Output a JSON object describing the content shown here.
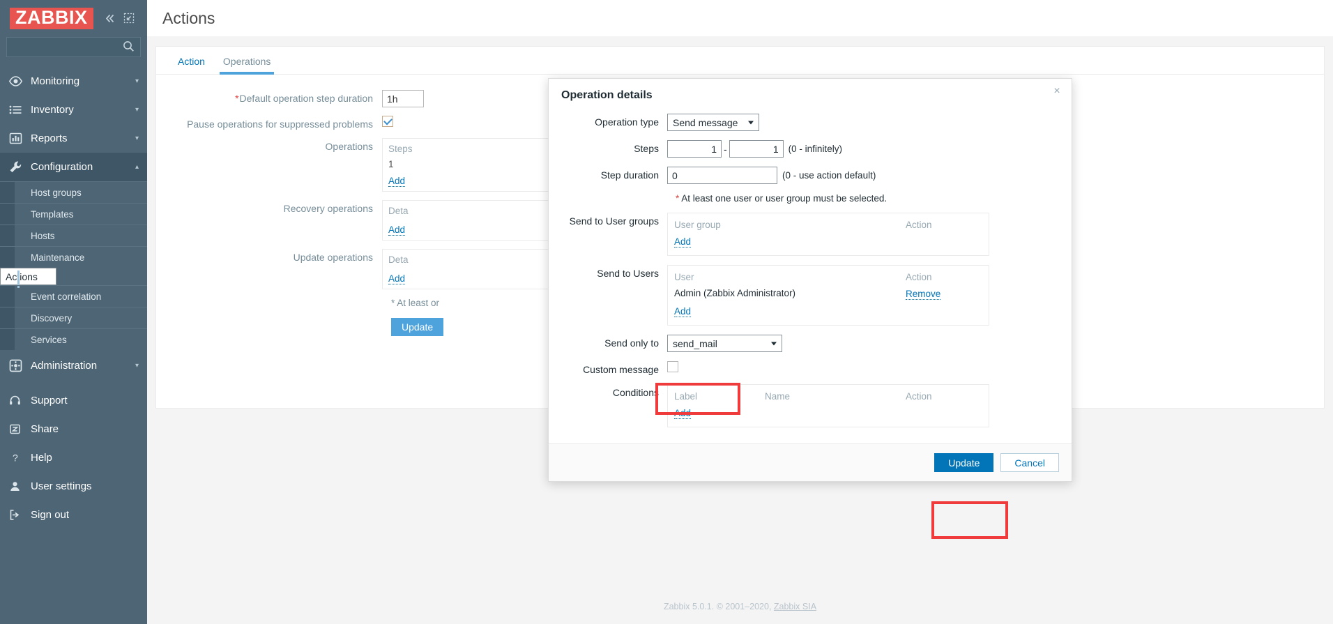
{
  "brand": {
    "name": "ZABBIX"
  },
  "sidebar": {
    "collapse_icon": "chevrons-left-icon",
    "expand_icon": "expand-icon",
    "search": {
      "placeholder": "",
      "value": "",
      "icon": "search-icon"
    },
    "groups": [
      {
        "label": "Monitoring",
        "icon": "eye-icon",
        "expanded": false
      },
      {
        "label": "Inventory",
        "icon": "list-icon",
        "expanded": false
      },
      {
        "label": "Reports",
        "icon": "bar-chart-icon",
        "expanded": false
      },
      {
        "label": "Configuration",
        "icon": "wrench-icon",
        "expanded": true
      }
    ],
    "configuration_items": [
      {
        "label": "Host groups",
        "selected": false
      },
      {
        "label": "Templates",
        "selected": false
      },
      {
        "label": "Hosts",
        "selected": false
      },
      {
        "label": "Maintenance",
        "selected": false
      },
      {
        "label": "Actions",
        "selected": true
      },
      {
        "label": "Event correlation",
        "selected": false
      },
      {
        "label": "Discovery",
        "selected": false
      },
      {
        "label": "Services",
        "selected": false
      }
    ],
    "administration": {
      "label": "Administration",
      "icon": "cog-square-icon"
    },
    "links": [
      {
        "label": "Support",
        "icon": "headset-icon"
      },
      {
        "label": "Share",
        "icon": "zabbix-z-icon"
      },
      {
        "label": "Help",
        "icon": "question-icon"
      },
      {
        "label": "User settings",
        "icon": "user-icon"
      },
      {
        "label": "Sign out",
        "icon": "sign-out-icon"
      }
    ]
  },
  "page": {
    "title": "Actions",
    "footer_text": "Zabbix 5.0.1. © 2001–2020, ",
    "footer_link": "Zabbix SIA"
  },
  "tabs": [
    {
      "label": "Action",
      "active": false
    },
    {
      "label": "Operations",
      "active": true
    }
  ],
  "background_form": {
    "default_step_duration": {
      "label": "Default operation step duration",
      "required": true,
      "value": "1h"
    },
    "pause_suppressed": {
      "label": "Pause operations for suppressed problems",
      "checked": true
    },
    "operations": {
      "label": "Operations",
      "header": "Steps",
      "row_value": "1",
      "add_label": "Add"
    },
    "recovery_operations": {
      "label": "Recovery operations",
      "header": "Deta",
      "add_label": "Add"
    },
    "update_operations": {
      "label": "Update operations",
      "header": "Deta",
      "add_label": "Add"
    },
    "note": "* At least or",
    "update_button": "Update"
  },
  "modal": {
    "title": "Operation details",
    "close_icon": "close-icon",
    "operation_type": {
      "label": "Operation type",
      "value": "Send message"
    },
    "steps": {
      "label": "Steps",
      "from": "1",
      "to": "1",
      "separator": "-",
      "hint": "(0 - infinitely)"
    },
    "step_duration": {
      "label": "Step duration",
      "value": "0",
      "hint": "(0 - use action default)"
    },
    "required_note": "At least one user or user group must be selected.",
    "send_to_user_groups": {
      "label": "Send to User groups",
      "columns": [
        "User group",
        "Action"
      ],
      "rows": [],
      "add_label": "Add"
    },
    "send_to_users": {
      "label": "Send to Users",
      "columns": [
        "User",
        "Action"
      ],
      "rows": [
        {
          "user": "Admin (Zabbix Administrator)",
          "action": "Remove"
        }
      ],
      "add_label": "Add"
    },
    "send_only_to": {
      "label": "Send only to",
      "value": "send_mail"
    },
    "custom_message": {
      "label": "Custom message",
      "checked": false
    },
    "conditions": {
      "label": "Conditions",
      "columns": [
        "Label",
        "Name",
        "Action"
      ],
      "rows": [],
      "add_label": "Add"
    },
    "footer": {
      "update_label": "Update",
      "cancel_label": "Cancel"
    }
  },
  "highlights": {
    "accent_red": "#ef3b3b",
    "targets": [
      "send-only-to-select",
      "modal-update-button"
    ]
  }
}
